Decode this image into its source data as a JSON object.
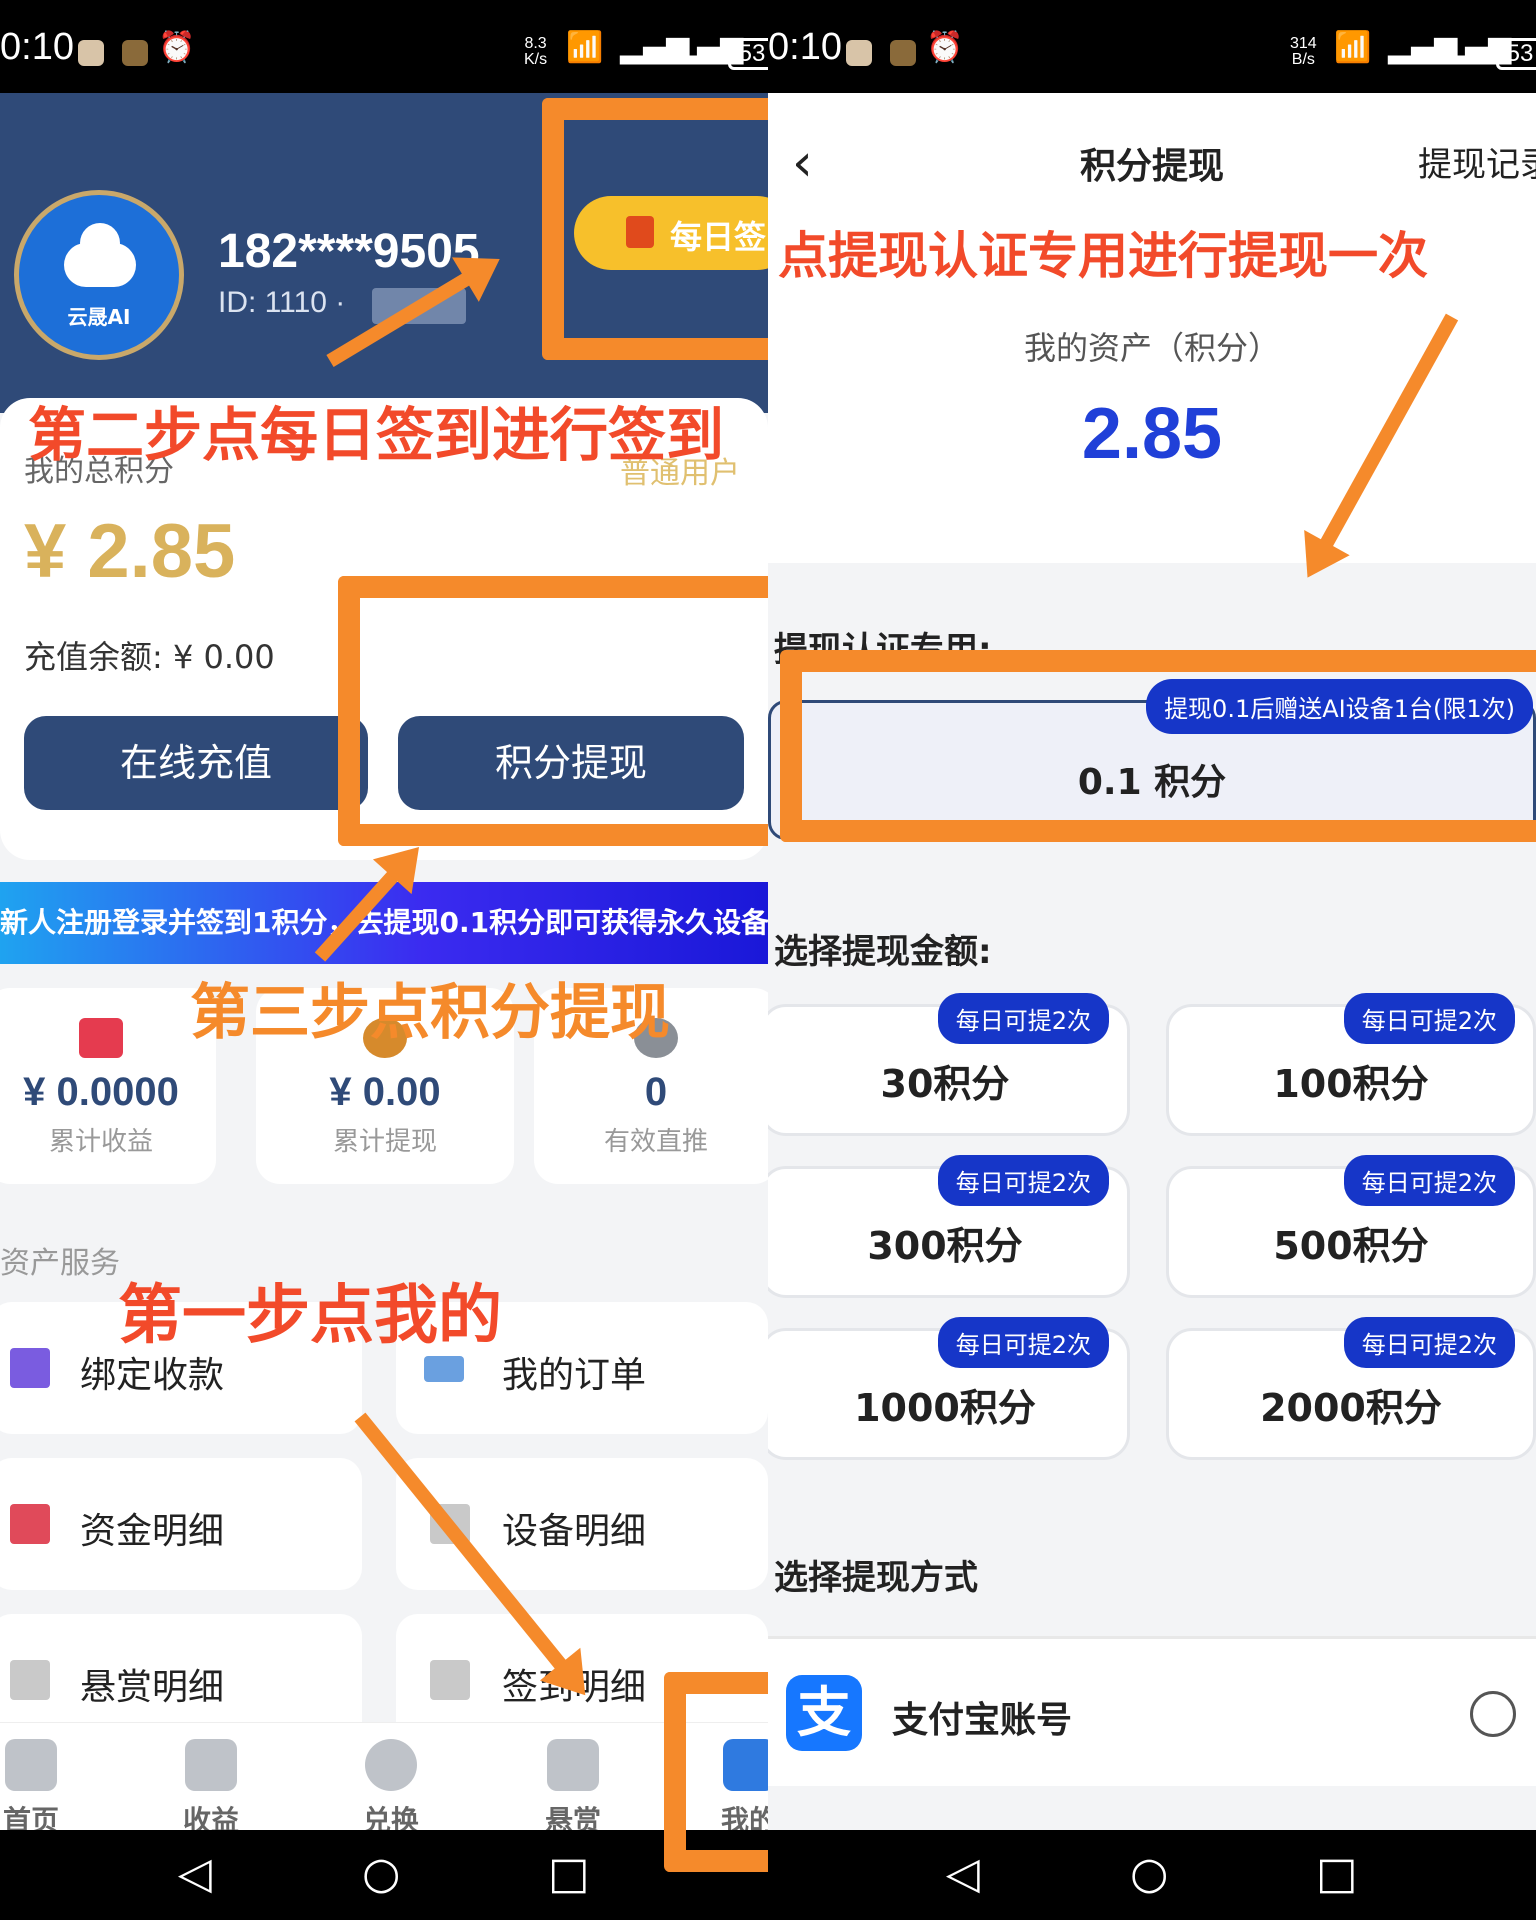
{
  "left": {
    "status": {
      "time": "0:10",
      "speed_top": "8.3",
      "speed_bot": "K/s",
      "battery": "53"
    },
    "header": {
      "avatar_label": "云晟AI",
      "phone": "182****9505",
      "uid": "ID: 1110 ·",
      "sign_label": "每日签"
    },
    "card": {
      "total_label": "我的总积分",
      "user_level": "普通用户",
      "total_value": "¥ 2.85",
      "recharge_line": "充值余额:  ¥ 0.00",
      "recharge_button": "在线充值",
      "withdraw_button": "积分提现"
    },
    "marquee": "新人注册登录并签到1积分，去提现0.1积分即可获得永久设备",
    "stats": [
      {
        "value": "¥ 0.0000",
        "label": "累计收益",
        "icon": "chart-up-icon",
        "color": "#e53b4f"
      },
      {
        "value": "¥ 0.00",
        "label": "累计提现",
        "icon": "money-bag-icon",
        "color": "#d68a2c"
      },
      {
        "value": "0",
        "label": "有效直推",
        "icon": "user-icon",
        "color": "#8a8f96"
      }
    ],
    "section_title": "资产服务",
    "services": [
      {
        "label": "绑定收款",
        "icon": "bar-chart-icon",
        "color": "#7a5ce0"
      },
      {
        "label": "我的订单",
        "icon": "card-icon",
        "color": "#6aa0e0"
      },
      {
        "label": "资金明细",
        "icon": "trend-icon",
        "color": "#e04a5a"
      },
      {
        "label": "设备明细",
        "icon": "receipt-icon",
        "color": "#c9c9c9"
      },
      {
        "label": "悬赏明细",
        "icon": "receipt-icon",
        "color": "#c9c9c9"
      },
      {
        "label": "签到明细",
        "icon": "receipt-icon",
        "color": "#c9c9c9"
      }
    ],
    "tabs": [
      {
        "label": "首页",
        "icon": "home-icon"
      },
      {
        "label": "收益",
        "icon": "income-icon"
      },
      {
        "label": "兑换",
        "icon": "exchange-icon"
      },
      {
        "label": "悬赏",
        "icon": "task-icon"
      },
      {
        "label": "我的",
        "icon": "profile-icon"
      }
    ],
    "annotations": {
      "step2": "第二步点每日签到进行签到",
      "step3": "第三步点积分提现",
      "step1": "第一步点我的"
    }
  },
  "right": {
    "status": {
      "time": "0:10",
      "speed_top": "314",
      "speed_bot": "B/s",
      "battery": "53"
    },
    "nav": {
      "title": "积分提现",
      "record": "提现记录"
    },
    "annotation": "点提现认证专用进行提现一次",
    "assets_label": "我的资产（积分）",
    "assets_value": "2.85",
    "cert_label": "提现认证专用:",
    "cert_tag": "提现0.1后赠送AI设备1台(限1次)",
    "cert_value": "0.1 积分",
    "amount_label": "选择提现金额:",
    "amounts": [
      {
        "value": "30积分",
        "tag": "每日可提2次"
      },
      {
        "value": "100积分",
        "tag": "每日可提2次"
      },
      {
        "value": "300积分",
        "tag": "每日可提2次"
      },
      {
        "value": "500积分",
        "tag": "每日可提2次"
      },
      {
        "value": "1000积分",
        "tag": "每日可提2次"
      },
      {
        "value": "2000积分",
        "tag": "每日可提2次"
      }
    ],
    "method_label": "选择提现方式",
    "pay_method": "支付宝账号",
    "pay_icon": "支"
  },
  "accent": "#2f4a78",
  "annotation_color": "#f58a2b"
}
